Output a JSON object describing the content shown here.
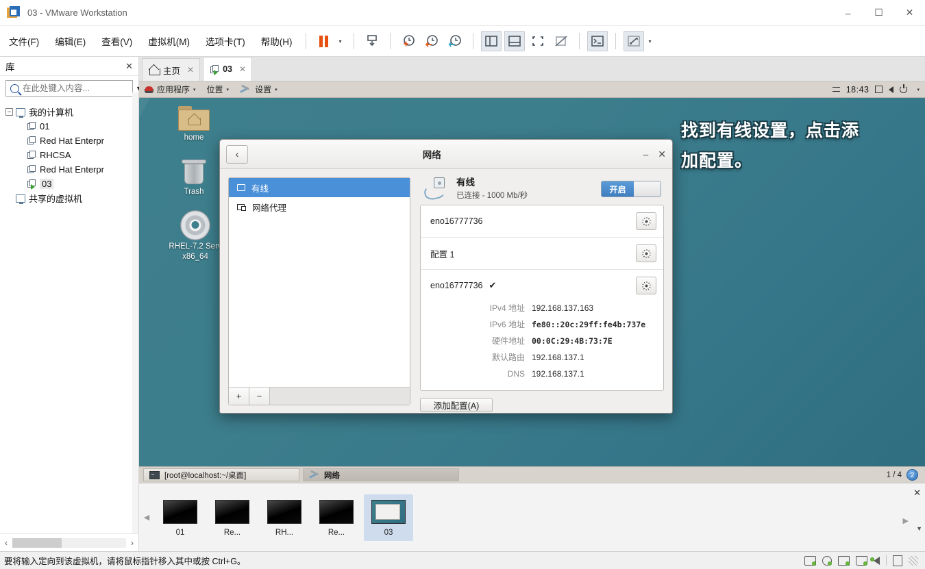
{
  "window": {
    "title": "03 - VMware Workstation",
    "minimize": "–",
    "maximize": "☐",
    "close": "✕"
  },
  "menubar": {
    "items": [
      {
        "label": "文件(F)",
        "name": "menu-file"
      },
      {
        "label": "编辑(E)",
        "name": "menu-edit"
      },
      {
        "label": "查看(V)",
        "name": "menu-view"
      },
      {
        "label": "虚拟机(M)",
        "name": "menu-vm"
      },
      {
        "label": "选项卡(T)",
        "name": "menu-tabs"
      },
      {
        "label": "帮助(H)",
        "name": "menu-help"
      }
    ],
    "caret": "▾"
  },
  "sidebar": {
    "title": "库",
    "close": "✕",
    "search_placeholder": "在此处键入内容...",
    "search_value": "",
    "dropdown_caret": "▼",
    "tree": {
      "root_label": "我的计算机",
      "expander": "−",
      "children": [
        {
          "label": "01",
          "selected": false,
          "running": false
        },
        {
          "label": "Red Hat Enterpr",
          "selected": false,
          "running": false
        },
        {
          "label": "RHCSA",
          "selected": false,
          "running": false
        },
        {
          "label": "Red Hat Enterpr",
          "selected": false,
          "running": false
        },
        {
          "label": "03",
          "selected": true,
          "running": true
        }
      ],
      "shared_label": "共享的虚拟机"
    },
    "scroll_left": "‹",
    "scroll_right": "›"
  },
  "tabs": [
    {
      "label": "主页",
      "name": "tab-home",
      "active": false,
      "close": "✕",
      "icon": "home-icon"
    },
    {
      "label": "03",
      "name": "tab-vm-03",
      "active": true,
      "close": "✕",
      "icon": "vm-icon"
    }
  ],
  "gnome_topbar": {
    "applications": "应用程序",
    "places": "位置",
    "settings": "设置",
    "caret": "▾",
    "clock": "18:43"
  },
  "desktop": {
    "icons": [
      {
        "label": "home",
        "name": "desktop-icon-home"
      },
      {
        "label": "Trash",
        "name": "desktop-icon-trash"
      },
      {
        "label": "RHEL-7.2 Serv\nx86_64",
        "name": "desktop-icon-rhel-iso"
      }
    ],
    "annotation_line1": "找到有线设置，点击添",
    "annotation_line2": "加配置。"
  },
  "network_dialog": {
    "title": "网络",
    "back": "‹",
    "minimize": "–",
    "close": "✕",
    "sidebar_items": [
      {
        "label": "有线",
        "selected": true,
        "icon": "wired-icon"
      },
      {
        "label": "网络代理",
        "selected": false,
        "icon": "proxy-icon"
      }
    ],
    "add_btn": "+",
    "remove_btn": "−",
    "wired": {
      "name": "有线",
      "status": "已连接 - 1000 Mb/秒",
      "toggle_label": "开启",
      "toggle_on": true
    },
    "rows": [
      {
        "label": "eno16777736",
        "name": "profile-row-eno16777736"
      },
      {
        "label": "配置 1",
        "name": "profile-row-config-1"
      }
    ],
    "active": {
      "label": "eno16777736",
      "check": "✔",
      "details": [
        {
          "label": "IPv4 地址",
          "value": "192.168.137.163",
          "mono": false
        },
        {
          "label": "IPv6 地址",
          "value": "fe80::20c:29ff:fe4b:737e",
          "mono": true
        },
        {
          "label": "硬件地址",
          "value": "00:0C:29:4B:73:7E",
          "mono": true
        },
        {
          "label": "默认路由",
          "value": "192.168.137.1",
          "mono": false
        },
        {
          "label": "DNS",
          "value": "192.168.137.1",
          "mono": false
        }
      ]
    },
    "add_config_btn": "添加配置(A)"
  },
  "gnome_taskbar": {
    "windows": [
      {
        "label": "[root@localhost:~/桌面]",
        "active": false,
        "icon": "terminal-icon"
      },
      {
        "label": "网络",
        "active": true,
        "icon": "tools-icon"
      }
    ],
    "workspace_text": "1 / 4",
    "workspace_badge": "2"
  },
  "thumbnails": {
    "left_arrow": "◀",
    "right_arrow": "▶",
    "close": "✕",
    "scroll_caret": "▼",
    "items": [
      {
        "label": "01",
        "selected": false,
        "live": false
      },
      {
        "label": "Re...",
        "selected": false,
        "live": false
      },
      {
        "label": "RH...",
        "selected": false,
        "live": false
      },
      {
        "label": "Re...",
        "selected": false,
        "live": false
      },
      {
        "label": "03",
        "selected": true,
        "live": true
      }
    ]
  },
  "statusbar": {
    "message": "要将输入定向到该虚拟机，请将鼠标指针移入其中或按 Ctrl+G。"
  },
  "colors": {
    "accent_blue": "#4a90d9",
    "vmware_orange": "#e8500f",
    "desktop_teal": "#3e7f8d",
    "selection_blue": "#cfdcee"
  }
}
